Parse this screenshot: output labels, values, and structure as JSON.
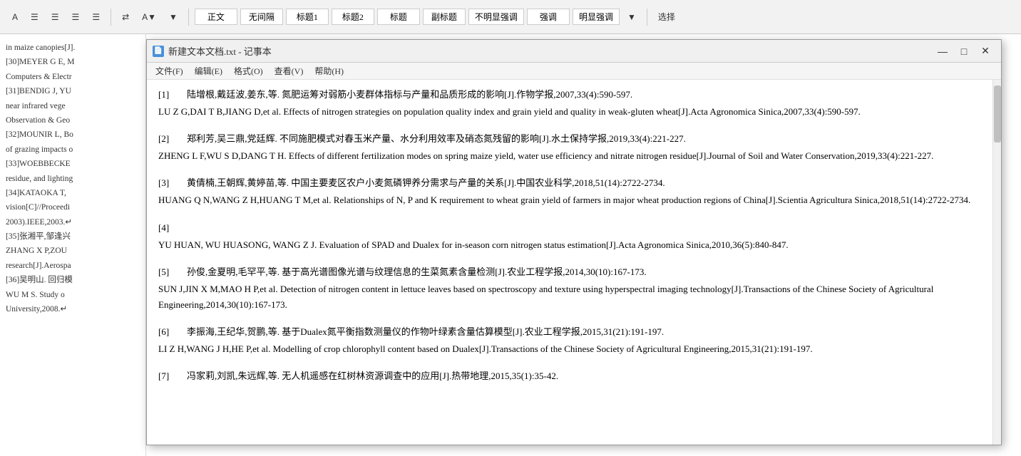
{
  "app": {
    "title": "新建文本文档.txt - 记事本",
    "icon_label": "📄"
  },
  "toolbar": {
    "styles": [
      "正文",
      "无间隔",
      "标题1",
      "标题2",
      "标题",
      "副标题",
      "不明显强调",
      "强调",
      "明显强调"
    ],
    "select_label": "选择"
  },
  "notepad": {
    "title": "新建文本文档.txt - 记事本",
    "menu_items": [
      "文件(F)",
      "编辑(E)",
      "格式(O)",
      "查看(V)",
      "帮助(H)"
    ]
  },
  "left_panel": {
    "items": [
      "in maize canopies[J].",
      "[30]MEYER G E, M",
      "Computers & Electr",
      "[31]BENDIG J, YU",
      "near  infrared  vege",
      "Observation & Geo",
      "[32]MOUNIR L, Bo",
      "of grazing impacts o",
      "[33]WOEBBECKE",
      "residue, and lighting",
      "[34]KATAOKA  T,",
      "vision[C]//Proceedi",
      "2003).IEEE,2003.↵",
      "[35]张湘平,邹逢兴",
      "ZHANG  X P,ZOU",
      "research[J].Aerospa",
      "[36]吴明山. 回归模",
      "WU M S. Study o",
      "University,2008.↵"
    ]
  },
  "references": [
    {
      "number": "[1]",
      "cn": "陆增根,戴廷波,姜东,等. 氮肥运筹对弱筋小麦群体指标与产量和品质形成的影响[J].作物学报,2007,33(4):590-597.",
      "en": "LU Z G,DAI T B,JIANG D,et al. Effects of nitrogen strategies on population quality index and grain yield and quality in weak-gluten wheat[J].Acta Agronomica Sinica,2007,33(4):590-597."
    },
    {
      "number": "[2]",
      "cn": "郑利芳,吴三鼎,党廷辉. 不同施肥模式对春玉米产量、水分利用效率及硝态氮残留的影响[J].水土保持学报,2019,33(4):221-227.",
      "en": "ZHENG L F,WU S D,DANG T H. Effects of different fertilization modes on spring maize yield, water use efficiency and nitrate nitrogen residue[J].Journal of Soil and Water Conservation,2019,33(4):221-227."
    },
    {
      "number": "[3]",
      "cn": "黄倩楠,王朝辉,黄婷苗,等. 中国主要麦区农户小麦氮磷钾养分需求与产量的关系[J].中国农业科学,2018,51(14):2722-2734.",
      "en": "HUANG Q N,WANG Z H,HUANG T M,et al. Relationships of N, P and K requirement to wheat grain yield of farmers in major wheat production regions of China[J].Scientia Agricultura Sinica,2018,51(14):2722-2734."
    },
    {
      "number": "[4]",
      "cn": "",
      "en": "YU HUAN, WU HUASONG, WANG Z J. Evaluation of SPAD and Dualex for in-season corn nitrogen status estimation[J].Acta Agronomica Sinica,2010,36(5):840-847."
    },
    {
      "number": "[5]",
      "cn": "孙俊,金夏明,毛罕平,等. 基于高光谱图像光谱与纹理信息的生菜氮素含量检测[J].农业工程学报,2014,30(10):167-173.",
      "en": "SUN J,JIN X M,MAO H P,et al. Detection of nitrogen content in lettuce leaves based on spectroscopy and texture using hyperspectral imaging technology[J].Transactions of the Chinese Society of Agricultural Engineering,2014,30(10):167-173."
    },
    {
      "number": "[6]",
      "cn": "李振海,王纪华,贺鹏,等. 基于Dualex氮平衡指数测量仪的作物叶绿素含量估算模型[J].农业工程学报,2015,31(21):191-197.",
      "en": "LI Z H,WANG J H,HE P,et al. Modelling of crop chlorophyll content based on Dualex[J].Transactions of the Chinese Society of Agricultural Engineering,2015,31(21):191-197."
    },
    {
      "number": "[7]",
      "cn": "冯家莉,刘凯,朱远辉,等. 无人机遥感在红树林资源调查中的应用[J].热带地理,2015,35(1):35-42.",
      "en": ""
    }
  ],
  "colors": {
    "bg": "#ffffff",
    "titlebar": "#f0f0f0",
    "menubar": "#f5f5f5",
    "text": "#000000",
    "accent": "#4a90d9"
  }
}
